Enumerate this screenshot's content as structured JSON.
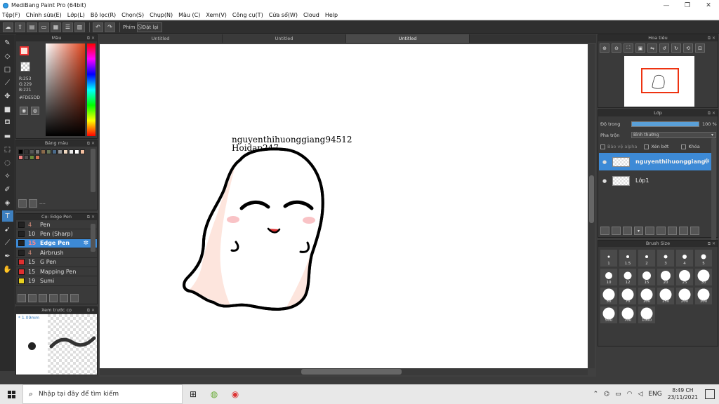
{
  "window": {
    "title": "MediBang Paint Pro (64bit)",
    "minimize": "—",
    "restore": "❐",
    "close": "✕"
  },
  "menu": [
    "Tệp(F)",
    "Chỉnh sửa(E)",
    "Lớp(L)",
    "Bộ lọc(R)",
    "Chọn(S)",
    "Chụp(N)",
    "Màu (C)",
    "Xem(V)",
    "Công cụ(T)",
    "Cửa sổ(W)",
    "Cloud",
    "Help"
  ],
  "toolbar": {
    "shortcut_label": "Phím",
    "reset_label": "Đặt lại"
  },
  "color_panel": {
    "title": "Màu",
    "r": "R:253",
    "g": "G:229",
    "b": "B:221",
    "hex": "#FDE5DD"
  },
  "palette_panel": {
    "title": "Bảng màu",
    "status": "----",
    "swatches": [
      "#000000",
      "#333333",
      "#555555",
      "#777777",
      "#8a6a4a",
      "#6a7a5a",
      "#4a6a8a",
      "#9a9a9a",
      "#f0d8c0",
      "#e8e8e8",
      "#ffffff",
      "#f4c0a0",
      "#f08080",
      "#505050",
      "#6a8a3a",
      "#d07050"
    ]
  },
  "brush_panel": {
    "title": "Cọ: Edge Pen",
    "items": [
      {
        "size": "4",
        "name": "Pen",
        "color": "#222222"
      },
      {
        "size": "10",
        "name": "Pen (Sharp)",
        "color": "#222222"
      },
      {
        "size": "15",
        "name": "Edge Pen",
        "color": "#222222"
      },
      {
        "size": "4",
        "name": "Airbrush",
        "color": "#222222"
      },
      {
        "size": "15",
        "name": "G Pen",
        "color": "#e03030"
      },
      {
        "size": "15",
        "name": "Mapping Pen",
        "color": "#e03030"
      },
      {
        "size": "19",
        "name": "Sumi",
        "color": "#e8d020"
      }
    ]
  },
  "preview_panel": {
    "title": "Xem trước cọ",
    "size": "1.09mm"
  },
  "canvas": {
    "tabs": [
      "Untitled",
      "Untitled",
      "Untitled"
    ],
    "text_line1": "nguyenthihuonggiang94512",
    "text_line2": "Hoidap247"
  },
  "navigator_panel": {
    "title": "Hoa tiêu"
  },
  "layer_panel": {
    "title": "Lớp",
    "opacity_label": "Độ trong",
    "opacity_value": "100 %",
    "blend_label": "Pha trộn",
    "blend_value": "Bình thường",
    "protect_alpha": "Bảo vệ alpha",
    "clipping": "Xén bớt",
    "lock": "Khóa",
    "layers": [
      {
        "name": "nguyenthihuonggiang"
      },
      {
        "name": "Lớp1"
      }
    ]
  },
  "size_panel": {
    "title": "Brush Size",
    "sizes": [
      "1",
      "1.5",
      "2",
      "3",
      "4",
      "5",
      "10",
      "12",
      "15",
      "20",
      "25",
      "30",
      "50",
      "70",
      "100",
      "150",
      "200",
      "300",
      "500",
      "700",
      "1000"
    ]
  },
  "taskbar": {
    "search_placeholder": "Nhập tại đây để tìm kiếm",
    "lang": "ENG",
    "time": "8:49 CH",
    "date": "23/11/2021"
  }
}
